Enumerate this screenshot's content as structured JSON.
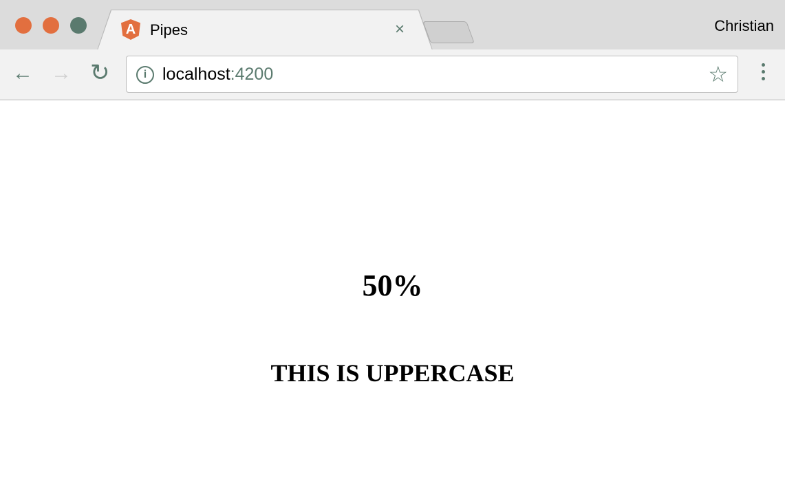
{
  "window": {
    "traffic_light_colors": [
      "#e26f3f",
      "#e26f3f",
      "#5a7a6e"
    ]
  },
  "tab": {
    "title": "Pipes",
    "favicon_letter": "A",
    "close": "×"
  },
  "profile": {
    "name": "Christian"
  },
  "toolbar": {
    "back": "←",
    "forward": "→",
    "reload": "↻",
    "url_host": "localhost",
    "url_port": ":4200",
    "info": "i",
    "star": "☆"
  },
  "content": {
    "percent": "50%",
    "uppercase": "THIS IS UPPERCASE"
  }
}
